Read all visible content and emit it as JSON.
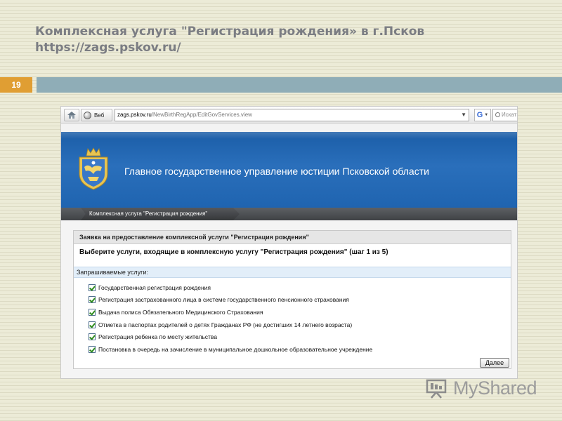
{
  "slide": {
    "title": "Комплексная услуга \"Регистрация рождения» в г.Псков",
    "url": "https://zags.pskov.ru/",
    "page_number": "19"
  },
  "browser": {
    "web_button": "Веб",
    "address_host": "zags.pskov.ru",
    "address_path": "/NewBirthRegApp/EditGovServices.view",
    "search_placeholder": "Искать в"
  },
  "site": {
    "org_name": "Главное государственное управление юстиции Псковской области",
    "breadcrumb": "Комплексная услуга \"Регистрация рождения\""
  },
  "form": {
    "panel_title": "Заявка на предоставление комплексной услуги \"Регистрация рождения\"",
    "step_heading": "Выберите услуги, входящие в комплексную услугу \"Регистрация рождения\" (шаг 1 из 5)",
    "section_label": "Запрашиваемые услуги:",
    "services": [
      {
        "label": "Государственная регистрация рождения",
        "checked": true
      },
      {
        "label": "Регистрация застрахованного лица в системе государственного пенсионного страхования",
        "checked": true
      },
      {
        "label": "Выдача полиса Обязательного Медицинского Страхования",
        "checked": true
      },
      {
        "label": "Отметка в паспортах родителей о детях Гражданах РФ (не достигших 14 летнего возраста)",
        "checked": true
      },
      {
        "label": "Регистрация ребенка по месту жительства",
        "checked": true
      },
      {
        "label": "Постановка в очередь на зачисление в муниципальное дошкольное образовательное учреждение",
        "checked": true
      }
    ],
    "next_label": "Далее"
  },
  "watermark": {
    "text": "MyShared"
  },
  "colors": {
    "slide_background": "#ecebd7",
    "page_badge": "#e09e33",
    "top_rule": "#8fadb7",
    "site_header": "#1f64b0",
    "breadcrumb_bar": "#4a4d50",
    "section_row": "#e2eef9",
    "check_mark": "#2e8c1d"
  },
  "icons": [
    "home-icon",
    "globe-icon",
    "go-arrow-icon",
    "google-icon",
    "search-icon",
    "crest-icon",
    "checkbox-checked-icon",
    "myshared-logo-icon"
  ]
}
